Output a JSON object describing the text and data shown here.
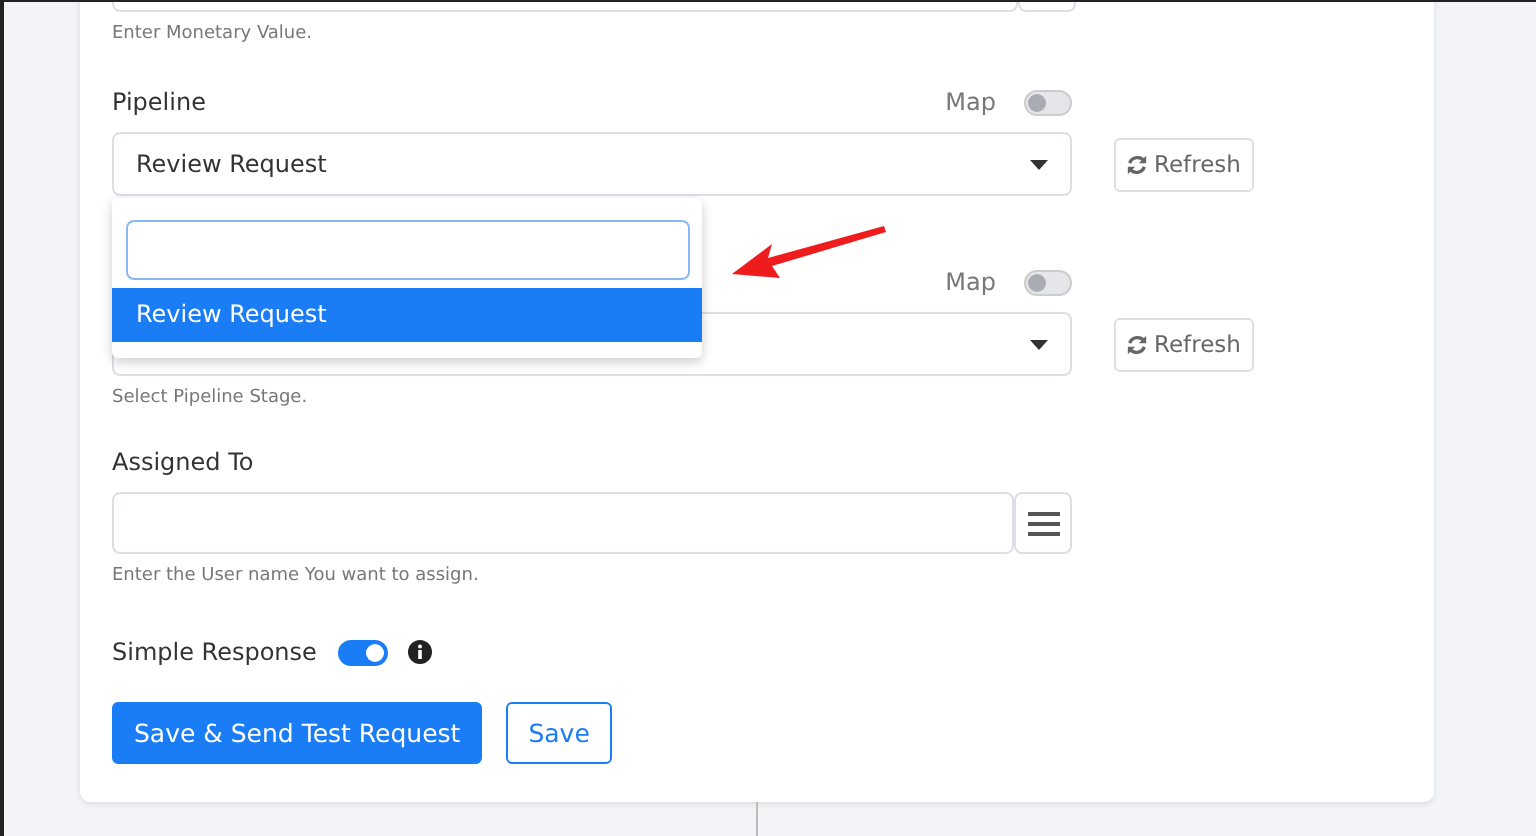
{
  "monetary": {
    "hint": "Enter Monetary Value."
  },
  "pipeline": {
    "label": "Pipeline",
    "map_label": "Map",
    "map_on": false,
    "value": "Review Request",
    "refresh": "Refresh"
  },
  "dropdown": {
    "options": [
      {
        "label": "Review Request",
        "selected": true
      }
    ]
  },
  "stage": {
    "map_label": "Map",
    "map_on": false,
    "refresh": "Refresh",
    "hint": "Select Pipeline Stage."
  },
  "assigned": {
    "label": "Assigned To",
    "hint": "Enter the User name You want to assign."
  },
  "simple_response": {
    "label": "Simple Response",
    "on": true
  },
  "buttons": [
    {
      "label": "Save & Send Test Request",
      "kind": "primary"
    },
    {
      "label": "Save",
      "kind": "outline"
    }
  ]
}
